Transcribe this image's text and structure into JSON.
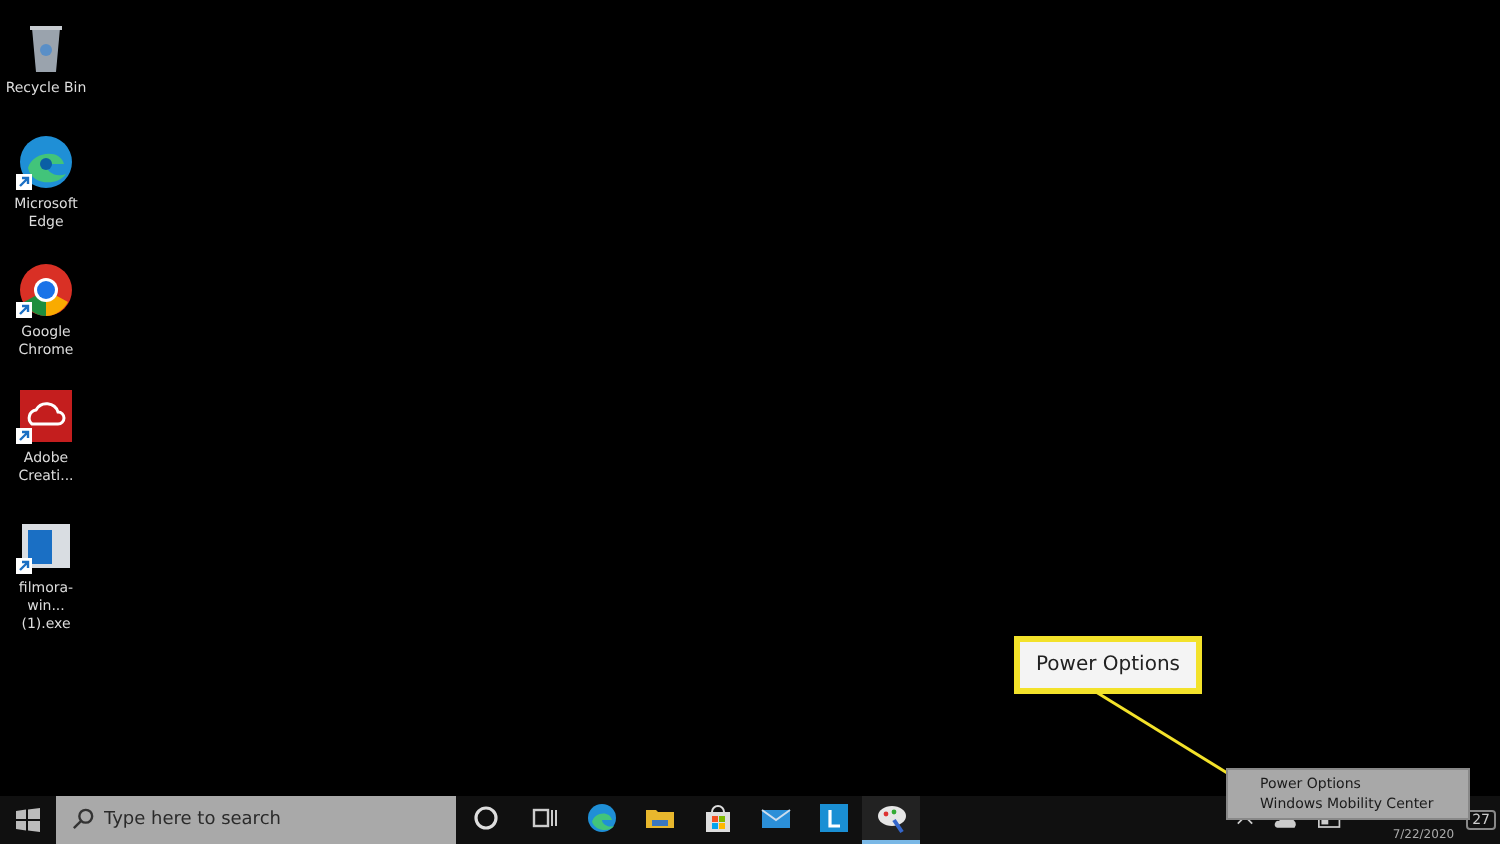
{
  "desktop_icons": [
    {
      "label": "Recycle Bin",
      "kind": "recycle",
      "shortcut": false
    },
    {
      "label": "Microsoft Edge",
      "kind": "edge",
      "shortcut": true
    },
    {
      "label": "Google Chrome",
      "kind": "chrome",
      "shortcut": true
    },
    {
      "label": "Adobe Creati...",
      "kind": "adobe",
      "shortcut": true
    },
    {
      "label": "filmora-win... (1).exe",
      "kind": "installer",
      "shortcut": true
    }
  ],
  "callout": {
    "label": "Power Options"
  },
  "context_menu": {
    "items": [
      {
        "label": "Power Options",
        "selected": false
      },
      {
        "label": "Windows Mobility Center",
        "selected": false
      }
    ]
  },
  "taskbar": {
    "search": {
      "placeholder": "Type here to search"
    },
    "apps": [
      {
        "kind": "cortana",
        "active": false
      },
      {
        "kind": "taskview",
        "active": false
      },
      {
        "kind": "edge",
        "active": false
      },
      {
        "kind": "explorer",
        "active": false
      },
      {
        "kind": "store",
        "active": false
      },
      {
        "kind": "mail",
        "active": false
      },
      {
        "kind": "letter",
        "active": false
      },
      {
        "kind": "paint",
        "active": true
      }
    ],
    "date": "7/22/2020",
    "notification_count": "27"
  }
}
